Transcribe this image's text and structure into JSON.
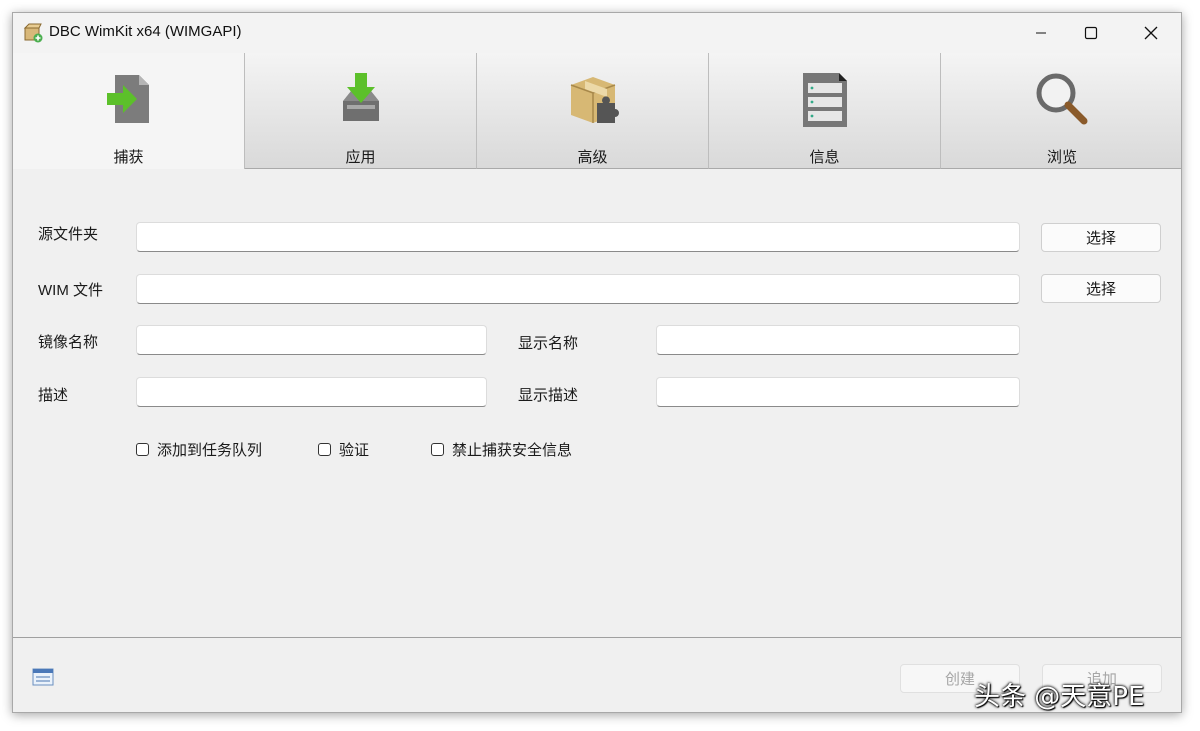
{
  "window": {
    "title": "DBC WimKit x64 (WIMGAPI)",
    "icons": {
      "app": "package-add-icon",
      "minimize": "minimize-icon",
      "maximize": "maximize-icon",
      "close": "close-icon"
    }
  },
  "tabs": [
    {
      "label": "捕获",
      "icon": "capture-arrow-icon",
      "active": true
    },
    {
      "label": "应用",
      "icon": "download-tray-icon",
      "active": false
    },
    {
      "label": "高级",
      "icon": "box-puzzle-icon",
      "active": false
    },
    {
      "label": "信息",
      "icon": "document-list-icon",
      "active": false
    },
    {
      "label": "浏览",
      "icon": "magnifier-icon",
      "active": false
    }
  ],
  "form": {
    "source_folder": {
      "label": "源文件夹",
      "value": ""
    },
    "wim_file": {
      "label": "WIM 文件",
      "value": ""
    },
    "image_name": {
      "label": "镜像名称",
      "value": ""
    },
    "display_name": {
      "label": "显示名称",
      "value": ""
    },
    "description": {
      "label": "描述",
      "value": ""
    },
    "display_description": {
      "label": "显示描述",
      "value": ""
    },
    "select_button_1": "选择",
    "select_button_2": "选择",
    "checkboxes": [
      {
        "label": "添加到任务队列",
        "checked": false
      },
      {
        "label": "验证",
        "checked": false
      },
      {
        "label": "禁止捕获安全信息",
        "checked": false
      }
    ]
  },
  "footer": {
    "status_icon": "status-list-icon",
    "create_button": "创建",
    "append_button": "追加"
  },
  "watermark": "头条 @天意PE",
  "colors": {
    "accent_green": "#5cc02a",
    "window_bg": "#f0f0f0"
  }
}
